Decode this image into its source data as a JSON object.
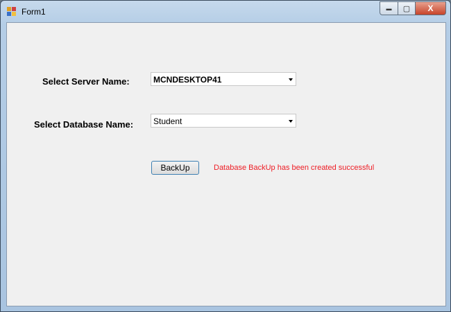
{
  "window": {
    "title": "Form1",
    "minimize_label": "▬",
    "maximize_label": "▢",
    "close_label": "X"
  },
  "form": {
    "server_label": "Select Server Name:",
    "server_value": "MCNDESKTOP41",
    "database_label": "Select Database Name:",
    "database_value": "Student",
    "backup_button": "BackUp",
    "status_message": "Database BackUp has been created successful",
    "status_color": "#ee1c24"
  }
}
